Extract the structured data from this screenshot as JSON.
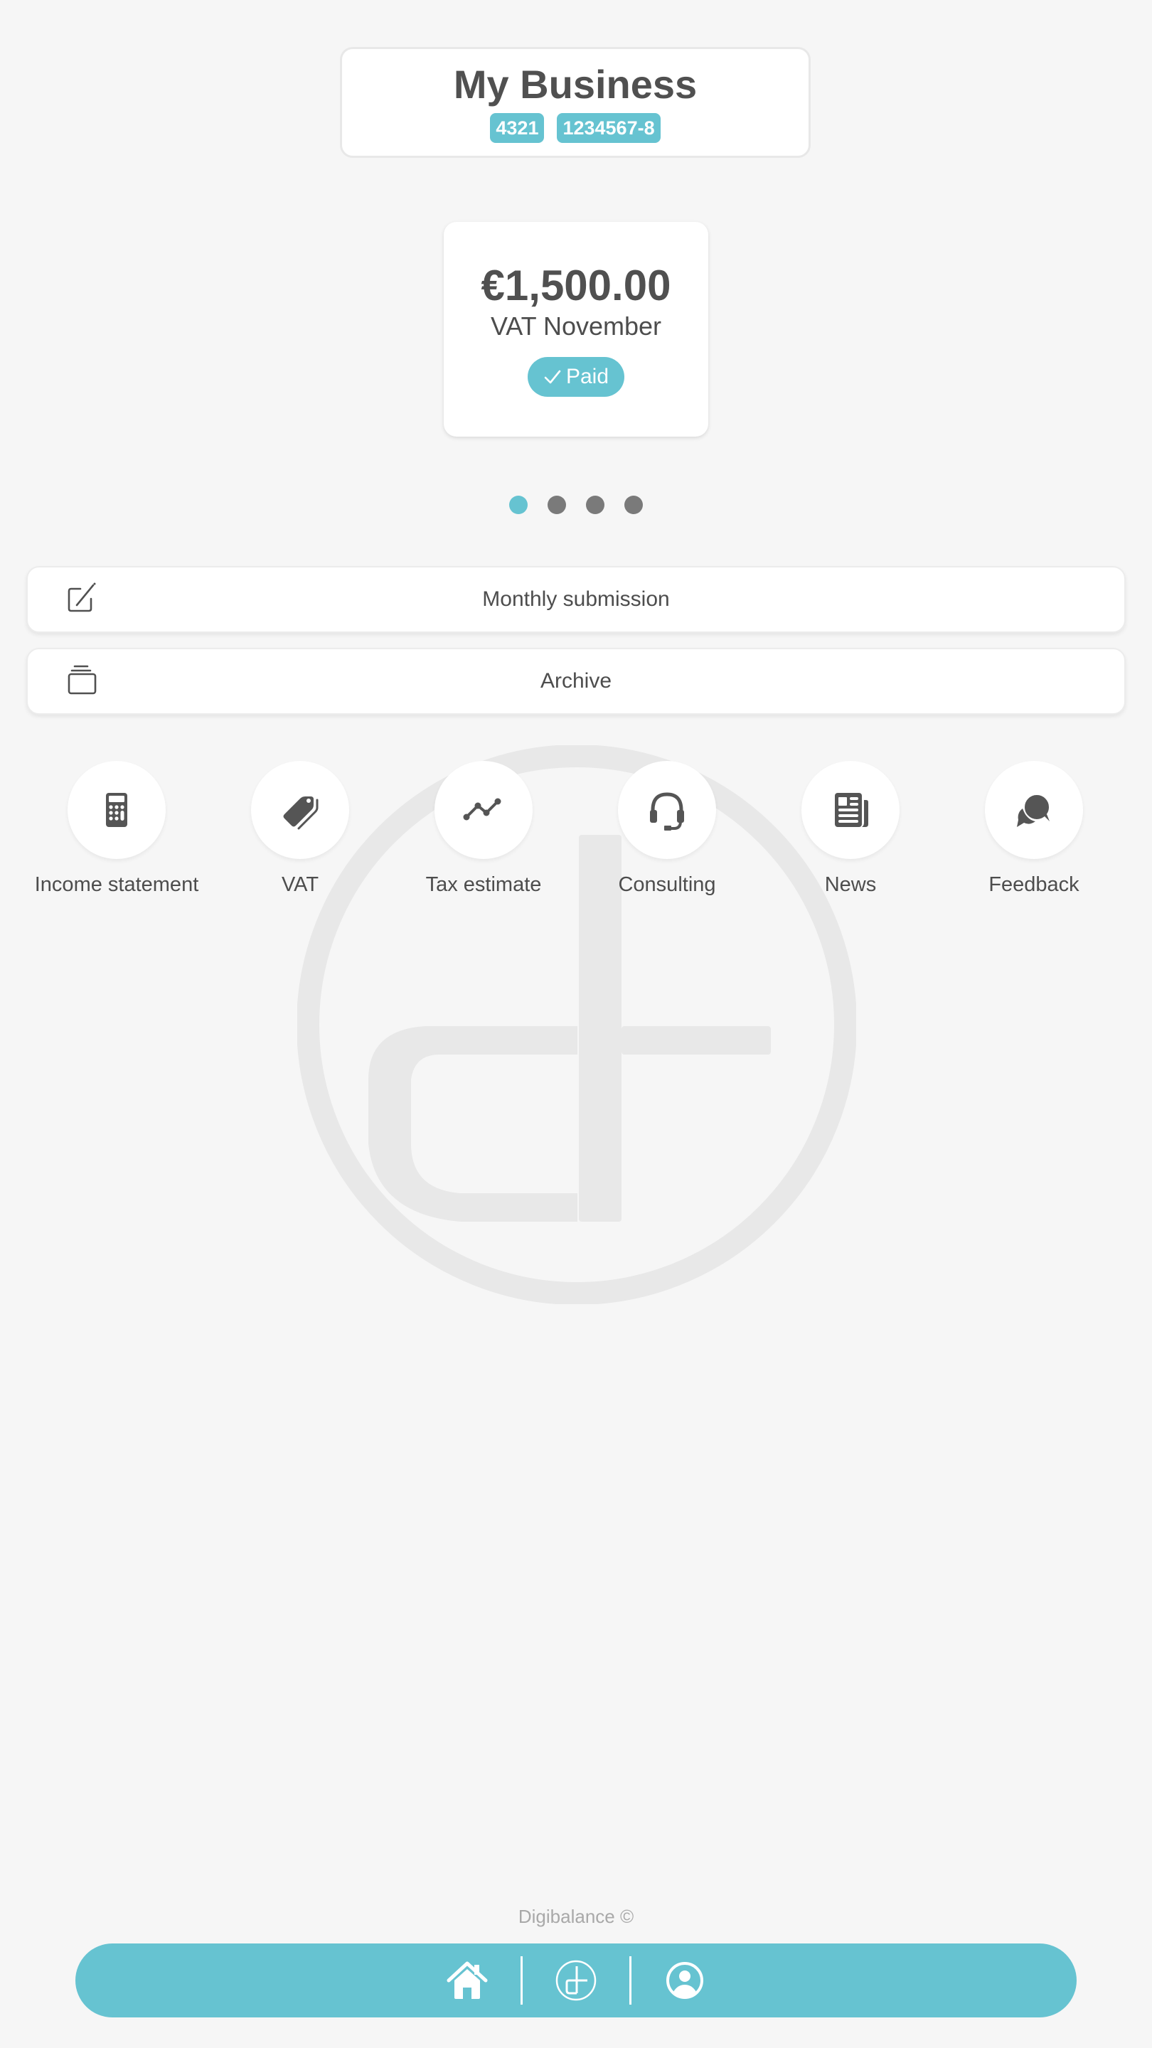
{
  "business": {
    "name": "My Business",
    "badges": [
      "4321",
      "1234567-8"
    ]
  },
  "carousel": {
    "cards": [
      {
        "amount": "€1,500.00",
        "label": "VAT November",
        "status": "Paid",
        "status_icon": "check-icon"
      }
    ],
    "page_count": 4,
    "active_index": 0
  },
  "actions": [
    {
      "label": "Monthly submission",
      "icon": "edit-icon"
    },
    {
      "label": "Archive",
      "icon": "archive-stack-icon"
    }
  ],
  "shortcuts": [
    {
      "label": "Income statement",
      "icon": "calculator-icon"
    },
    {
      "label": "VAT",
      "icon": "tags-icon"
    },
    {
      "label": "Tax estimate",
      "icon": "line-chart-icon"
    },
    {
      "label": "Consulting",
      "icon": "headset-icon"
    },
    {
      "label": "News",
      "icon": "newspaper-icon"
    },
    {
      "label": "Feedback",
      "icon": "chat-bubbles-icon"
    }
  ],
  "footer": {
    "copyright": "Digibalance ©"
  },
  "bottom_nav": [
    {
      "name": "home",
      "icon": "home-icon"
    },
    {
      "name": "digibalance",
      "icon": "digibalance-logo-icon"
    },
    {
      "name": "profile",
      "icon": "user-circle-icon"
    }
  ],
  "colors": {
    "accent": "#66c3d1",
    "text": "#4d4d4d",
    "background": "#f6f6f6",
    "dot_inactive": "#7a7a7a"
  }
}
